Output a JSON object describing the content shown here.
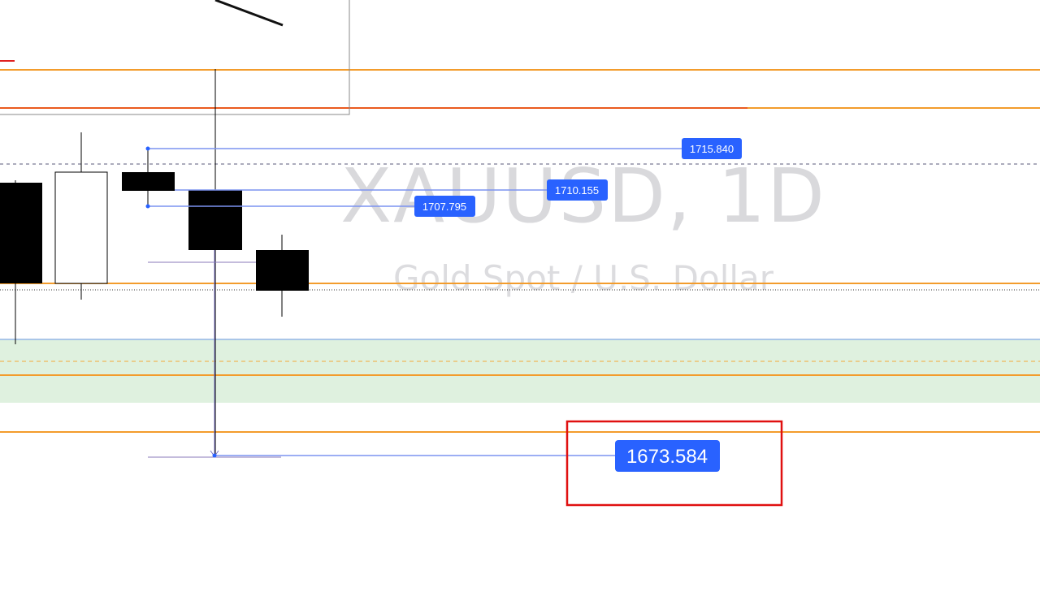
{
  "watermark": {
    "symbol": "XAUUSD, 1D",
    "description": "Gold Spot / U.S. Dollar"
  },
  "colors": {
    "candle_body": "#000000",
    "hollow_candle": "#ffffff",
    "level_line": "#f39c2c",
    "range_zone": "#dcefdc",
    "label_bg": "#2962ff",
    "measure_line": "#6b74ff",
    "highlight_box": "#e01010"
  },
  "chart_data": {
    "type": "candlestick",
    "candles": [
      {
        "open": 1714,
        "high": 1714,
        "low": 1691,
        "close": 1697,
        "direction": "down"
      },
      {
        "open": 1697,
        "high": 1718,
        "low": 1694,
        "close": 1714,
        "direction": "up"
      },
      {
        "open": 1714,
        "high": 1715.84,
        "low": 1707.795,
        "close": 1710.155,
        "direction": "down"
      },
      {
        "open": 1710.155,
        "high": 1727,
        "low": 1673.584,
        "close": 1701,
        "direction": "down"
      },
      {
        "open": 1701,
        "high": 1702.5,
        "low": 1692.5,
        "close": 1695.5,
        "direction": "down"
      }
    ],
    "horizontal_levels": [
      1728,
      1723,
      1697,
      1691,
      1685,
      1680
    ],
    "support_zone": [
      1683,
      1690.5
    ],
    "price_labels": [
      {
        "id": "high",
        "value": "1715.840"
      },
      {
        "id": "close",
        "value": "1710.155"
      },
      {
        "id": "low",
        "value": "1707.795"
      },
      {
        "id": "target",
        "value": "1673.584"
      }
    ]
  }
}
